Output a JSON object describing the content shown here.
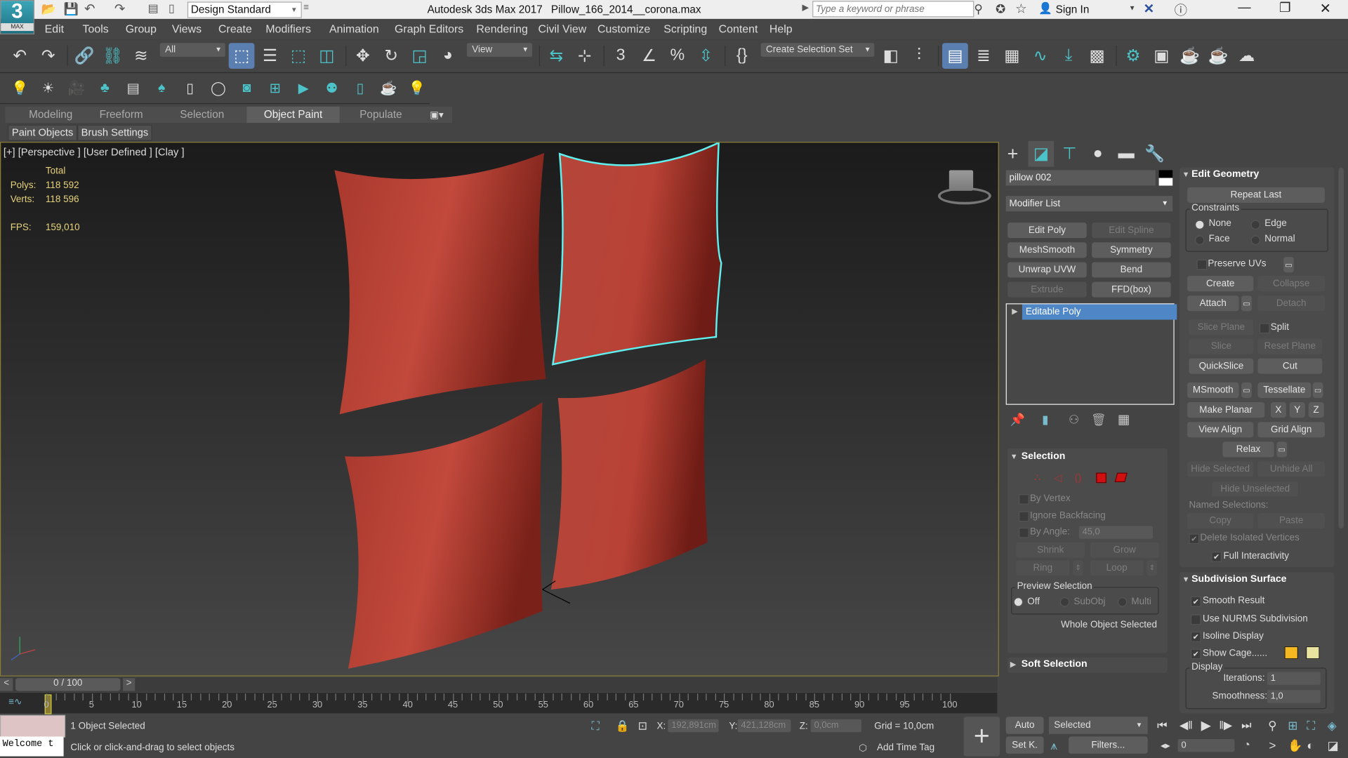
{
  "titlebar": {
    "app": "Autodesk 3ds Max 2017",
    "file": "Pillow_166_2014__corona.max",
    "workspace": "Design Standard",
    "search_placeholder": "Type a keyword or phrase",
    "sign_in": "Sign In",
    "logo": "3",
    "logo_sub": "MAX"
  },
  "menu": [
    "Edit",
    "Tools",
    "Group",
    "Views",
    "Create",
    "Modifiers",
    "Animation",
    "Graph Editors",
    "Rendering",
    "Civil View",
    "Customize",
    "Scripting",
    "Content",
    "Help"
  ],
  "toolbar": {
    "filter": "All",
    "ref_coord": "View",
    "selection_set": "Create Selection Set",
    "icons": [
      "undo",
      "redo",
      "|",
      "link",
      "unlink",
      "bind-space-warp",
      "DD",
      "select-object",
      "select-by-name",
      "rect-selection",
      "window-crossing",
      "|",
      "move",
      "rotate",
      "scale",
      "place",
      "DD2",
      "|",
      "mirror",
      "align",
      "|",
      "snap-3d",
      "angle-snap",
      "percent-snap",
      "spinner-snap",
      "|",
      "edit-named-sel",
      "DD3",
      "mirror-axis",
      "align-tool",
      "|",
      "scene-explorer",
      "layer-explorer",
      "ribbon-toggle",
      "curve-editor",
      "schematic-view",
      "material-editor",
      "|",
      "render-setup",
      "rendered-frame",
      "render",
      "render-iterative",
      "render-cloud"
    ],
    "icons2": [
      "light",
      "sun",
      "camera",
      "tree",
      "list",
      "forest",
      "tree-doc",
      "ring",
      "image",
      "frame-in",
      "play-frame",
      "camera-add",
      "panel",
      "teapot",
      "bulb"
    ]
  },
  "ribbon": {
    "tabs": [
      "Modeling",
      "Freeform",
      "Selection",
      "Object Paint",
      "Populate"
    ],
    "active": 3,
    "subtabs": [
      "Paint Objects",
      "Brush Settings"
    ]
  },
  "viewport": {
    "label": "[+] [Perspective ] [User Defined ] [Clay ]",
    "total": "Total",
    "polys_label": "Polys:",
    "polys": "118 592",
    "verts_label": "Verts:",
    "verts": "118 596",
    "fps_label": "FPS:",
    "fps": "159,010"
  },
  "panel": {
    "object_name": "pillow 002",
    "modifier_list": "Modifier List",
    "modifiers": [
      {
        "label": "Edit Poly",
        "enabled": true
      },
      {
        "label": "Edit Spline",
        "enabled": false
      },
      {
        "label": "MeshSmooth",
        "enabled": true
      },
      {
        "label": "Symmetry",
        "enabled": true
      },
      {
        "label": "Unwrap UVW",
        "enabled": true
      },
      {
        "label": "Bend",
        "enabled": true
      },
      {
        "label": "Extrude",
        "enabled": false
      },
      {
        "label": "FFD(box)",
        "enabled": true
      }
    ],
    "stack_item": "Editable Poly",
    "selection": {
      "title": "Selection",
      "by_vertex": "By Vertex",
      "ignore_backfacing": "Ignore Backfacing",
      "by_angle": "By Angle:",
      "angle": "45,0",
      "shrink": "Shrink",
      "grow": "Grow",
      "ring": "Ring",
      "loop": "Loop",
      "preview": "Preview Selection",
      "off": "Off",
      "subobj": "SubObj",
      "multi": "Multi",
      "status": "Whole Object Selected"
    },
    "soft_selection": "Soft Selection",
    "edit_geometry": {
      "title": "Edit Geometry",
      "repeat_last": "Repeat Last",
      "constraints": "Constraints",
      "none": "None",
      "edge": "Edge",
      "face": "Face",
      "normal": "Normal",
      "preserve_uvs": "Preserve UVs",
      "create": "Create",
      "collapse": "Collapse",
      "attach": "Attach",
      "detach": "Detach",
      "slice_plane": "Slice Plane",
      "split": "Split",
      "slice": "Slice",
      "reset_plane": "Reset Plane",
      "quickslice": "QuickSlice",
      "cut": "Cut",
      "msmooth": "MSmooth",
      "tessellate": "Tessellate",
      "make_planar": "Make Planar",
      "x": "X",
      "y": "Y",
      "z": "Z",
      "view_align": "View Align",
      "grid_align": "Grid Align",
      "relax": "Relax",
      "hide_selected": "Hide Selected",
      "unhide_all": "Unhide All",
      "hide_unselected": "Hide Unselected",
      "named_selections": "Named Selections:",
      "copy": "Copy",
      "paste": "Paste",
      "delete_isolated": "Delete Isolated Vertices",
      "full_interactivity": "Full Interactivity"
    },
    "subdivision": {
      "title": "Subdivision Surface",
      "smooth_result": "Smooth Result",
      "use_nurms": "Use NURMS Subdivision",
      "isoline": "Isoline Display",
      "show_cage": "Show Cage......",
      "display": "Display",
      "iterations_label": "Iterations:",
      "iterations": "1",
      "smoothness_label": "Smoothness:",
      "smoothness": "1,0",
      "cage_color_1": "#f5b820",
      "cage_color_2": "#e8e4a0"
    }
  },
  "timeline": {
    "frame": "0 / 100",
    "ticks": [
      "0",
      "5",
      "10",
      "15",
      "20",
      "25",
      "30",
      "35",
      "40",
      "45",
      "50",
      "55",
      "60",
      "65",
      "70",
      "75",
      "80",
      "85",
      "90",
      "95",
      "100"
    ]
  },
  "status": {
    "selected": "1 Object Selected",
    "prompt": "Click or click-and-drag to select objects",
    "listener": "Welcome t",
    "x_label": "X:",
    "x": "192,891cm",
    "y_label": "Y:",
    "y": "421,128cm",
    "z_label": "Z:",
    "z": "0,0cm",
    "grid": "Grid = 10,0cm",
    "add_time_tag": "Add Time Tag",
    "auto": "Auto",
    "key_mode": "Selected",
    "set_key": "Set K.",
    "filters": "Filters...",
    "current_frame": "0"
  },
  "colors": {
    "accent": "#4cc3c8",
    "selection_outline": "#5ff0f0",
    "pillow": "#b9443a",
    "viewport_border": "#8a7b35"
  }
}
